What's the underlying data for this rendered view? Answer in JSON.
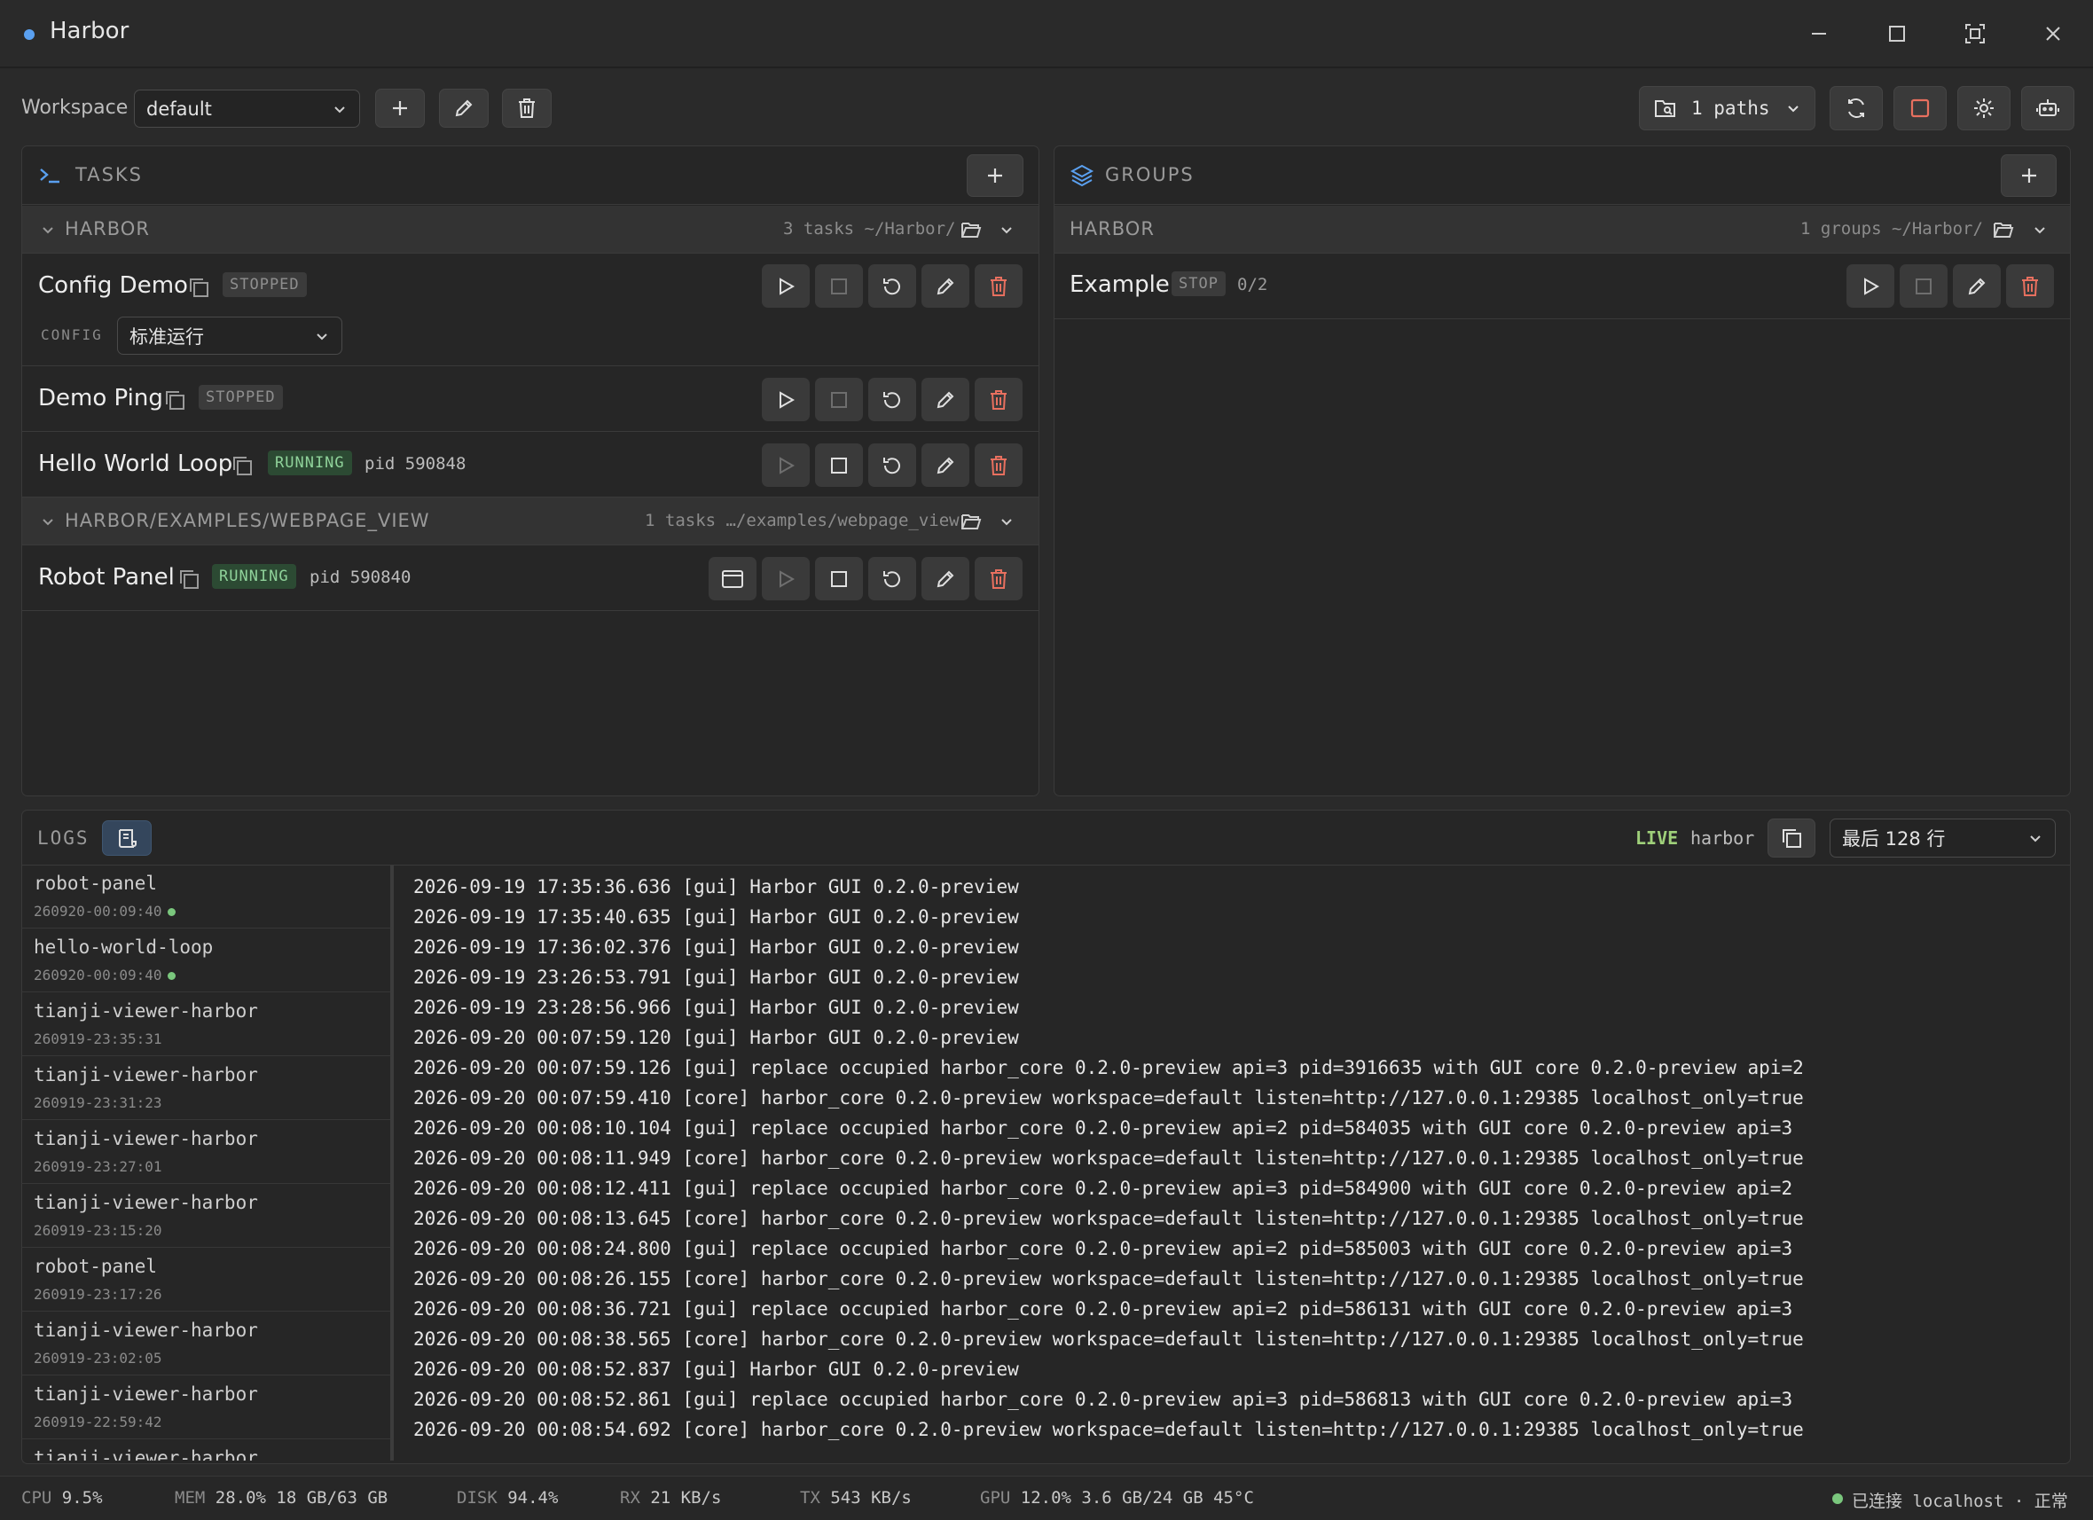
{
  "app": {
    "title": "Harbor"
  },
  "toolbar": {
    "workspace_label": "Workspace",
    "workspace_value": "default",
    "paths_label": "1 paths"
  },
  "tasks": {
    "title": "TASKS",
    "groups": [
      {
        "name": "HARBOR",
        "meta": "3 tasks ~/Harbor/",
        "items": [
          {
            "name": "Config Demo",
            "status": "STOPPED",
            "pid": "",
            "config_label": "CONFIG",
            "config_value": "标准运行"
          },
          {
            "name": "Demo Ping",
            "status": "STOPPED",
            "pid": ""
          },
          {
            "name": "Hello World Loop",
            "status": "RUNNING",
            "pid": "pid 590848"
          }
        ]
      },
      {
        "name": "HARBOR/EXAMPLES/WEBPAGE_VIEW",
        "meta": "1 tasks …/examples/webpage_view",
        "items": [
          {
            "name": "Robot Panel",
            "status": "RUNNING",
            "pid": "pid 590840"
          }
        ]
      }
    ]
  },
  "groups_panel": {
    "title": "GROUPS",
    "group_name": "HARBOR",
    "meta": "1 groups ~/Harbor/",
    "items": [
      {
        "name": "Example",
        "status": "STOP",
        "count": "0/2"
      }
    ]
  },
  "logs": {
    "title": "LOGS",
    "live_label": "LIVE",
    "source": "harbor",
    "range_value": "最后 128 行",
    "sessions": [
      {
        "name": "robot-panel",
        "time": "260920-00:09:40",
        "active": true
      },
      {
        "name": "hello-world-loop",
        "time": "260920-00:09:40",
        "active": true
      },
      {
        "name": "tianji-viewer-harbor",
        "time": "260919-23:35:31",
        "active": false
      },
      {
        "name": "tianji-viewer-harbor",
        "time": "260919-23:31:23",
        "active": false
      },
      {
        "name": "tianji-viewer-harbor",
        "time": "260919-23:27:01",
        "active": false
      },
      {
        "name": "tianji-viewer-harbor",
        "time": "260919-23:15:20",
        "active": false
      },
      {
        "name": "robot-panel",
        "time": "260919-23:17:26",
        "active": false
      },
      {
        "name": "tianji-viewer-harbor",
        "time": "260919-23:02:05",
        "active": false
      },
      {
        "name": "tianji-viewer-harbor",
        "time": "260919-22:59:42",
        "active": false
      },
      {
        "name": "tianji-viewer-harbor",
        "time": "",
        "active": false
      }
    ],
    "lines": [
      "2026-09-19 17:35:36.636 [gui] Harbor GUI 0.2.0-preview",
      "2026-09-19 17:35:40.635 [gui] Harbor GUI 0.2.0-preview",
      "2026-09-19 17:36:02.376 [gui] Harbor GUI 0.2.0-preview",
      "2026-09-19 23:26:53.791 [gui] Harbor GUI 0.2.0-preview",
      "2026-09-19 23:28:56.966 [gui] Harbor GUI 0.2.0-preview",
      "2026-09-20 00:07:59.120 [gui] Harbor GUI 0.2.0-preview",
      "2026-09-20 00:07:59.126 [gui] replace occupied harbor_core 0.2.0-preview api=3 pid=3916635 with GUI core 0.2.0-preview api=2",
      "2026-09-20 00:07:59.410 [core] harbor_core 0.2.0-preview workspace=default listen=http://127.0.0.1:29385 localhost_only=true",
      "2026-09-20 00:08:10.104 [gui] replace occupied harbor_core 0.2.0-preview api=2 pid=584035 with GUI core 0.2.0-preview api=3",
      "2026-09-20 00:08:11.949 [core] harbor_core 0.2.0-preview workspace=default listen=http://127.0.0.1:29385 localhost_only=true",
      "2026-09-20 00:08:12.411 [gui] replace occupied harbor_core 0.2.0-preview api=3 pid=584900 with GUI core 0.2.0-preview api=2",
      "2026-09-20 00:08:13.645 [core] harbor_core 0.2.0-preview workspace=default listen=http://127.0.0.1:29385 localhost_only=true",
      "2026-09-20 00:08:24.800 [gui] replace occupied harbor_core 0.2.0-preview api=2 pid=585003 with GUI core 0.2.0-preview api=3",
      "2026-09-20 00:08:26.155 [core] harbor_core 0.2.0-preview workspace=default listen=http://127.0.0.1:29385 localhost_only=true",
      "2026-09-20 00:08:36.721 [gui] replace occupied harbor_core 0.2.0-preview api=2 pid=586131 with GUI core 0.2.0-preview api=3",
      "2026-09-20 00:08:38.565 [core] harbor_core 0.2.0-preview workspace=default listen=http://127.0.0.1:29385 localhost_only=true",
      "2026-09-20 00:08:52.837 [gui] Harbor GUI 0.2.0-preview",
      "2026-09-20 00:08:52.861 [gui] replace occupied harbor_core 0.2.0-preview api=3 pid=586813 with GUI core 0.2.0-preview api=3",
      "2026-09-20 00:08:54.692 [core] harbor_core 0.2.0-preview workspace=default listen=http://127.0.0.1:29385 localhost_only=true"
    ]
  },
  "statusbar": {
    "cpu_label": "CPU",
    "cpu_value": "9.5%",
    "mem_label": "MEM",
    "mem_value": "28.0% 18 GB/63 GB",
    "disk_label": "DISK",
    "disk_value": "94.4%",
    "rx_label": "RX",
    "rx_value": "21 KB/s",
    "tx_label": "TX",
    "tx_value": "543 KB/s",
    "gpu_label": "GPU",
    "gpu_value": "12.0% 3.6 GB/24 GB 45°C",
    "connection": "已连接 localhost · 正常"
  },
  "colors": {
    "accent": "#5aa0f0",
    "running": "#8fd29a",
    "danger": "#e8705f",
    "live": "#9fd07a"
  }
}
